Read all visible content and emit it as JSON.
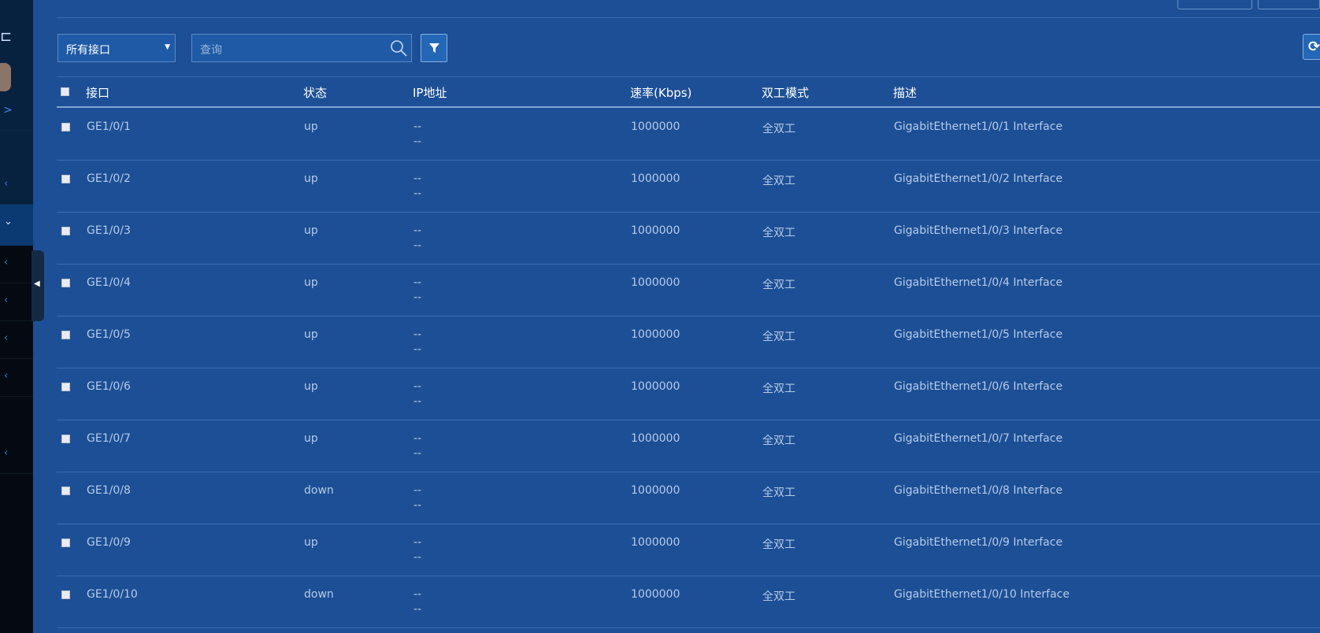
{
  "toolbar": {
    "interface_filter": "所有接口",
    "search_placeholder": "查询"
  },
  "table": {
    "columns": [
      "接口",
      "状态",
      "IP地址",
      "速率(Kbps)",
      "双工模式",
      "描述"
    ],
    "rows": [
      {
        "iface": "GE1/0/1",
        "status": "up",
        "ip1": "--",
        "ip2": "--",
        "speed": "1000000",
        "duplex": "全双工",
        "desc": "GigabitEthernet1/0/1 Interface"
      },
      {
        "iface": "GE1/0/2",
        "status": "up",
        "ip1": "--",
        "ip2": "--",
        "speed": "1000000",
        "duplex": "全双工",
        "desc": "GigabitEthernet1/0/2 Interface"
      },
      {
        "iface": "GE1/0/3",
        "status": "up",
        "ip1": "--",
        "ip2": "--",
        "speed": "1000000",
        "duplex": "全双工",
        "desc": "GigabitEthernet1/0/3 Interface"
      },
      {
        "iface": "GE1/0/4",
        "status": "up",
        "ip1": "--",
        "ip2": "--",
        "speed": "1000000",
        "duplex": "全双工",
        "desc": "GigabitEthernet1/0/4 Interface"
      },
      {
        "iface": "GE1/0/5",
        "status": "up",
        "ip1": "--",
        "ip2": "--",
        "speed": "1000000",
        "duplex": "全双工",
        "desc": "GigabitEthernet1/0/5 Interface"
      },
      {
        "iface": "GE1/0/6",
        "status": "up",
        "ip1": "--",
        "ip2": "--",
        "speed": "1000000",
        "duplex": "全双工",
        "desc": "GigabitEthernet1/0/6 Interface"
      },
      {
        "iface": "GE1/0/7",
        "status": "up",
        "ip1": "--",
        "ip2": "--",
        "speed": "1000000",
        "duplex": "全双工",
        "desc": "GigabitEthernet1/0/7 Interface"
      },
      {
        "iface": "GE1/0/8",
        "status": "down",
        "ip1": "--",
        "ip2": "--",
        "speed": "1000000",
        "duplex": "全双工",
        "desc": "GigabitEthernet1/0/8 Interface"
      },
      {
        "iface": "GE1/0/9",
        "status": "up",
        "ip1": "--",
        "ip2": "--",
        "speed": "1000000",
        "duplex": "全双工",
        "desc": "GigabitEthernet1/0/9 Interface"
      },
      {
        "iface": "GE1/0/10",
        "status": "down",
        "ip1": "--",
        "ip2": "--",
        "speed": "1000000",
        "duplex": "全双工",
        "desc": "GigabitEthernet1/0/10 Interface"
      }
    ]
  },
  "colors": {
    "background": "#1c4f96",
    "sidebar": "#050a12",
    "header_text": "#ffffff",
    "cell_text": "#b8cbe6"
  }
}
